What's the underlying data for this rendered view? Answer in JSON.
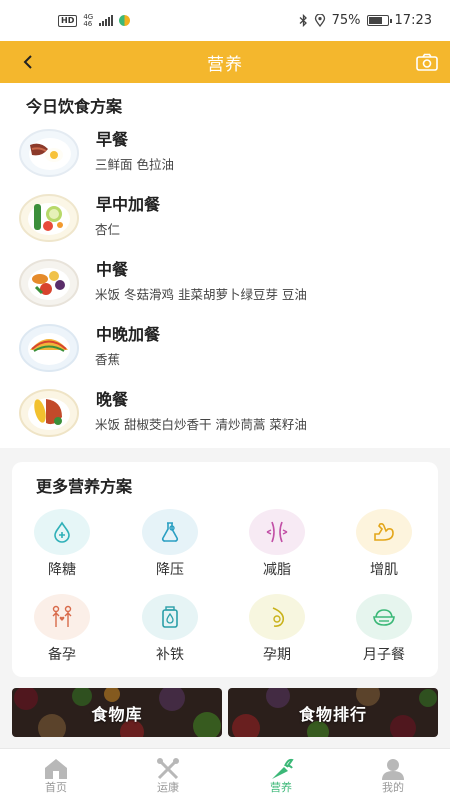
{
  "status_bar": {
    "hd": "HD",
    "network_top": "4G",
    "network_bottom": "46",
    "battery": "75%",
    "time": "17:23"
  },
  "header": {
    "title": "营养",
    "back_icon": "chevron-left-icon",
    "camera_icon": "camera-icon"
  },
  "today_plan": {
    "title": "今日饮食方案",
    "meals": [
      {
        "name": "早餐",
        "desc": "三鲜面 色拉油",
        "icon": "breakfast-plate-icon"
      },
      {
        "name": "早中加餐",
        "desc": "杏仁",
        "icon": "snack-plate-icon"
      },
      {
        "name": "中餐",
        "desc": "米饭 冬菇滑鸡 韭菜胡萝卜绿豆芽 豆油",
        "icon": "lunch-plate-icon"
      },
      {
        "name": "中晚加餐",
        "desc": "香蕉",
        "icon": "afternoon-snack-plate-icon"
      },
      {
        "name": "晚餐",
        "desc": "米饭 甜椒茭白炒香干 清炒茼蒿 菜籽油",
        "icon": "dinner-plate-icon"
      }
    ]
  },
  "more_plans": {
    "title": "更多营养方案",
    "items": [
      {
        "label": "降糖",
        "icon": "blood-sugar-drop-icon",
        "color": "#e6f6f7"
      },
      {
        "label": "降压",
        "icon": "blood-pressure-flask-icon",
        "color": "#e6f3f8"
      },
      {
        "label": "减脂",
        "icon": "waist-slim-icon",
        "color": "#f7eaf4"
      },
      {
        "label": "增肌",
        "icon": "flexed-arm-icon",
        "color": "#fdf4dd"
      },
      {
        "label": "备孕",
        "icon": "couple-heart-icon",
        "color": "#fbefe8"
      },
      {
        "label": "补铁",
        "icon": "iron-bottle-icon",
        "color": "#e6f4f5"
      },
      {
        "label": "孕期",
        "icon": "pregnancy-belly-icon",
        "color": "#f7f6df"
      },
      {
        "label": "月子餐",
        "icon": "food-bowl-icon",
        "color": "#e6f5ee"
      }
    ]
  },
  "banners": {
    "food_library": "食物库",
    "food_ranking": "食物排行"
  },
  "bottom_nav": {
    "items": [
      {
        "label": "首页",
        "icon": "home-icon"
      },
      {
        "label": "运康",
        "icon": "exercise-tools-icon"
      },
      {
        "label": "营养",
        "icon": "carrot-icon"
      },
      {
        "label": "我的",
        "icon": "user-icon"
      }
    ],
    "active_color": "#3cb878"
  },
  "colors": {
    "header": "#f4b72d",
    "active": "#3cb878"
  }
}
